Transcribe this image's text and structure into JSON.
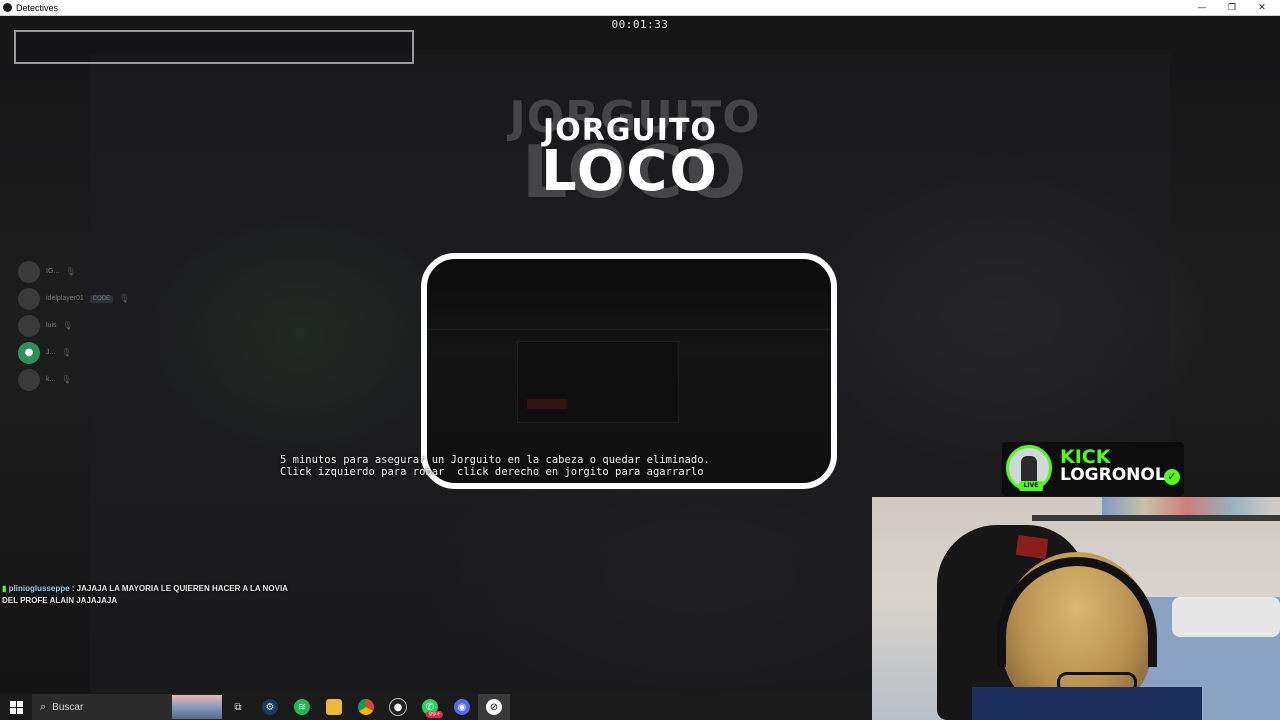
{
  "window": {
    "title": "Detectives",
    "controls": {
      "minimize": "—",
      "restore": "❐",
      "close": "✕"
    }
  },
  "hud": {
    "timer": "00:01:33"
  },
  "game_logo": {
    "line1": "JORGUITO",
    "line2": "LOCO"
  },
  "instructions": {
    "line1": "5 minutos para asegurar un Jorguito en la cabeza o quedar eliminado.",
    "line2": "Click izquierdo para robar  click derecho en jorgito para agarrarlo"
  },
  "voice_overlay": {
    "members": [
      {
        "name": "IG...",
        "badge": ""
      },
      {
        "name": "idelplayer01",
        "badge": "CODE"
      },
      {
        "name": "luis",
        "badge": ""
      },
      {
        "name": "J...",
        "badge": ""
      },
      {
        "name": "k...",
        "badge": ""
      }
    ]
  },
  "chat": {
    "username": "plinioglusseppe",
    "message": ": JAJAJA LA MAYORIA LE QUIEREN HACER A LA NOVIA DEL PROFE ALAIN JAJAJAJA"
  },
  "stream_overlay": {
    "platform": "KICK",
    "username": "LOGRONOL",
    "live_label": "LIVE",
    "accent_color": "#53fc18"
  },
  "taskbar": {
    "search_placeholder": "Buscar",
    "notification_count": "99+",
    "apps": [
      "task-view",
      "steam",
      "spotify",
      "file-explorer",
      "chrome",
      "obs",
      "whatsapp",
      "discord",
      "game"
    ]
  }
}
